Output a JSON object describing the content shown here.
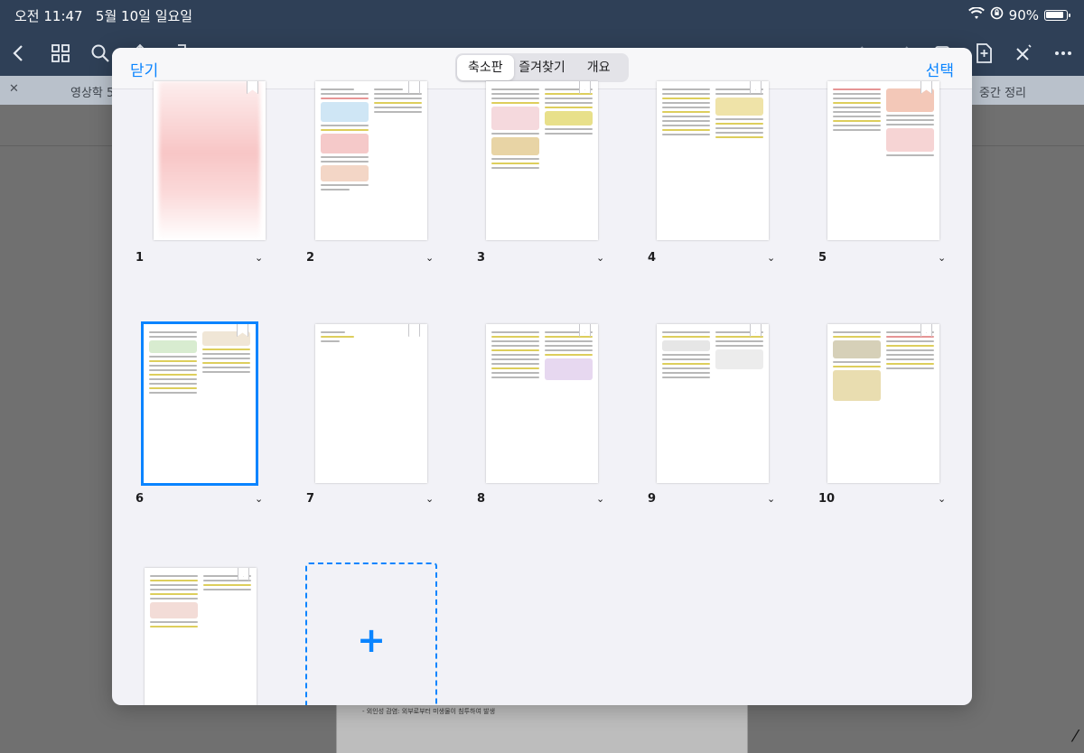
{
  "status": {
    "time": "오전 11:47",
    "date": "5월 10일 일요일",
    "battery": "90%"
  },
  "toolbar": {
    "doc_title": "____________",
    "icons": [
      "back-icon",
      "grid-icon",
      "search-icon",
      "share-icon",
      "bookmark-icon",
      "undo-icon",
      "redo-icon",
      "page-icon",
      "add-page-icon",
      "close-pencil-icon",
      "more-icon"
    ]
  },
  "tabs": {
    "left": "영상학 5",
    "right": "중간 정리"
  },
  "document": {
    "text": "- 외인성 감염: 외부로부터 미생물이 침투하여 발생"
  },
  "modal": {
    "close_label": "닫기",
    "select_label": "선택",
    "segments": [
      "축소판",
      "즐겨찾기",
      "개요"
    ],
    "active_segment": "축소판"
  },
  "pages": [
    {
      "num": "1"
    },
    {
      "num": "2"
    },
    {
      "num": "3"
    },
    {
      "num": "4"
    },
    {
      "num": "5"
    },
    {
      "num": "6"
    },
    {
      "num": "7"
    },
    {
      "num": "8"
    },
    {
      "num": "9"
    },
    {
      "num": "10"
    }
  ],
  "add_page_symbol": "+",
  "colors": {
    "accent": "#0a84ff",
    "appbar": "#2f4057"
  }
}
